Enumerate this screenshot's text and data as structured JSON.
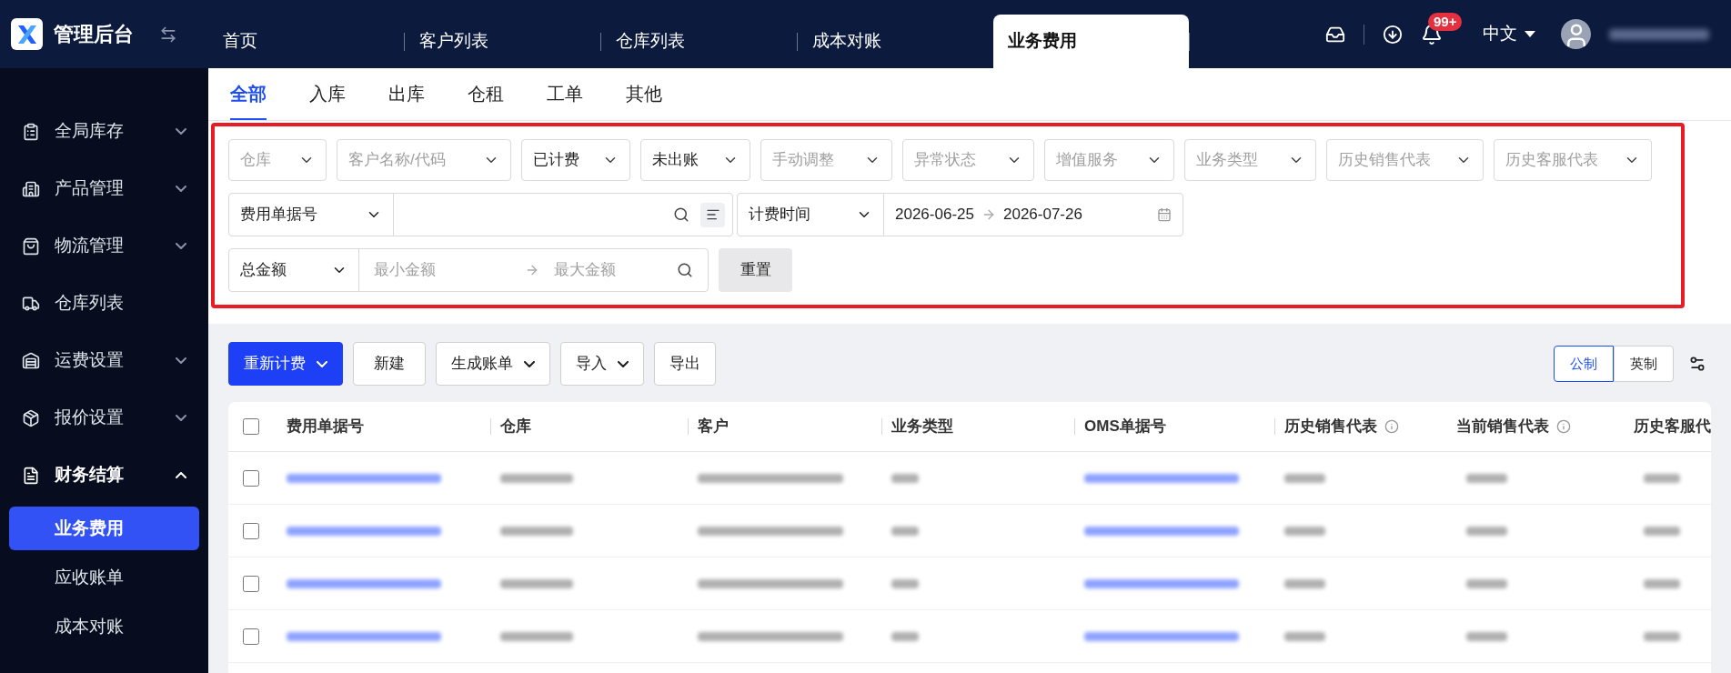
{
  "app": {
    "title": "管理后台"
  },
  "top_tabs": [
    {
      "label": "首页",
      "selected": false
    },
    {
      "label": "客户列表",
      "selected": false
    },
    {
      "label": "仓库列表",
      "selected": false
    },
    {
      "label": "成本对账",
      "selected": false
    },
    {
      "label": "业务费用",
      "selected": true
    }
  ],
  "header": {
    "notifications": "99+",
    "language": "中文"
  },
  "sidebar": {
    "items": [
      {
        "label": "全局库存",
        "kind": "menu",
        "expanded": false
      },
      {
        "label": "产品管理",
        "kind": "menu",
        "expanded": false
      },
      {
        "label": "物流管理",
        "kind": "menu",
        "expanded": false
      },
      {
        "label": "仓库列表",
        "kind": "link"
      },
      {
        "label": "运费设置",
        "kind": "menu",
        "expanded": false
      },
      {
        "label": "报价设置",
        "kind": "menu",
        "expanded": false
      },
      {
        "label": "财务结算",
        "kind": "menu",
        "expanded": true,
        "children": [
          {
            "label": "业务费用",
            "selected": true
          },
          {
            "label": "应收账单",
            "selected": false
          },
          {
            "label": "成本对账",
            "selected": false
          }
        ]
      }
    ]
  },
  "sub_tabs": [
    {
      "label": "全部",
      "selected": true
    },
    {
      "label": "入库",
      "selected": false
    },
    {
      "label": "出库",
      "selected": false
    },
    {
      "label": "仓租",
      "selected": false
    },
    {
      "label": "工单",
      "selected": false
    },
    {
      "label": "其他",
      "selected": false
    }
  ],
  "filters": {
    "selects": [
      {
        "placeholder": "仓库"
      },
      {
        "placeholder": "客户名称/代码"
      },
      {
        "value": "已计费"
      },
      {
        "value": "未出账"
      },
      {
        "placeholder": "手动调整"
      },
      {
        "placeholder": "异常状态"
      },
      {
        "placeholder": "增值服务"
      },
      {
        "placeholder": "业务类型"
      },
      {
        "placeholder": "历史销售代表"
      },
      {
        "placeholder": "历史客服代表"
      }
    ],
    "doc_search": {
      "field": "费用单据号"
    },
    "date_range": {
      "field": "计费时间",
      "start": "2026-06-25",
      "end": "2026-07-26"
    },
    "amount_range": {
      "field": "总金额",
      "min_placeholder": "最小金额",
      "max_placeholder": "最大金额"
    },
    "reset": "重置"
  },
  "toolbar": {
    "buttons": [
      {
        "label": "重新计费",
        "kind": "primary",
        "dropdown": true
      },
      {
        "label": "新建",
        "kind": "default",
        "dropdown": false
      },
      {
        "label": "生成账单",
        "kind": "default",
        "dropdown": true
      },
      {
        "label": "导入",
        "kind": "default",
        "dropdown": true
      },
      {
        "label": "导出",
        "kind": "default",
        "dropdown": false
      }
    ],
    "units": [
      {
        "label": "公制",
        "selected": true
      },
      {
        "label": "英制",
        "selected": false
      }
    ]
  },
  "table": {
    "header_checked": false,
    "columns": [
      {
        "label": "费用单据号",
        "info": false
      },
      {
        "label": "仓库",
        "info": false
      },
      {
        "label": "客户",
        "info": false
      },
      {
        "label": "业务类型",
        "info": false
      },
      {
        "label": "OMS单据号",
        "info": false
      },
      {
        "label": "历史销售代表",
        "info": true
      },
      {
        "label": "当前销售代表",
        "info": true
      },
      {
        "label": "历史客服代",
        "info": false
      }
    ],
    "rows": [
      {
        "checked": false
      },
      {
        "checked": false
      },
      {
        "checked": false
      },
      {
        "checked": false
      }
    ]
  }
}
